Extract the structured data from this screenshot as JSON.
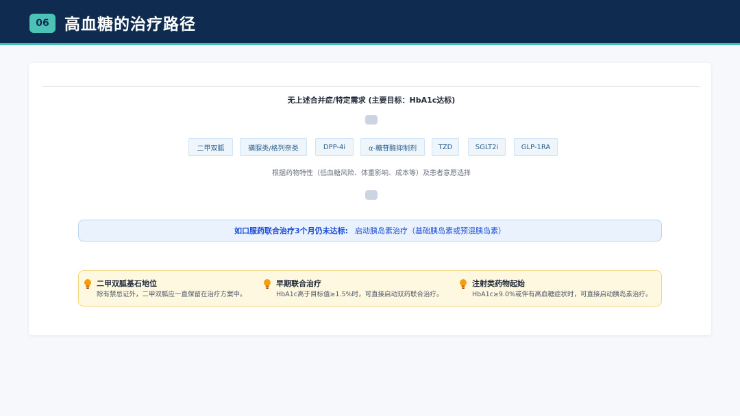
{
  "header": {
    "badge": "06",
    "title": "高血糖的治疗路径",
    "background_color": "#0f2b4f",
    "accent_color": "#3fc1b8"
  },
  "flow": {
    "top_label": "无上述合并症/特定需求 (主要目标：HbA1c达标)",
    "drugs": [
      "二甲双胍",
      "磺脲类/格列奈类",
      "DPP-4i",
      "α-糖苷酶抑制剂",
      "TZD",
      "SGLT2i",
      "GLP-1RA"
    ],
    "selection_note": "根据药物特性（低血糖风险、体重影响、成本等）及患者意愿选择",
    "insulin": {
      "label": "如口服药联合治疗3个月仍未达标:",
      "value": "启动胰岛素治疗（基础胰岛素或预混胰岛素）"
    }
  },
  "tips": [
    {
      "icon": "lightbulb-icon",
      "title": "二甲双胍基石地位",
      "text": "除有禁忌证外，二甲双胍应一直保留在治疗方案中。"
    },
    {
      "icon": "lightbulb-icon",
      "title": "早期联合治疗",
      "text": "HbA1c高于目标值≥1.5%时，可直接启动双药联合治疗。"
    },
    {
      "icon": "lightbulb-icon",
      "title": "注射类药物起始",
      "text": "HbA1c≥9.0%或伴有高血糖症状时，可直接启动胰岛素治疗。"
    }
  ],
  "colors": {
    "tag_background": "#eef6fc",
    "insulin_box_background": "#eaf3fd",
    "tips_background": "#fff8e1",
    "tip_icon": "#f59e0b"
  }
}
